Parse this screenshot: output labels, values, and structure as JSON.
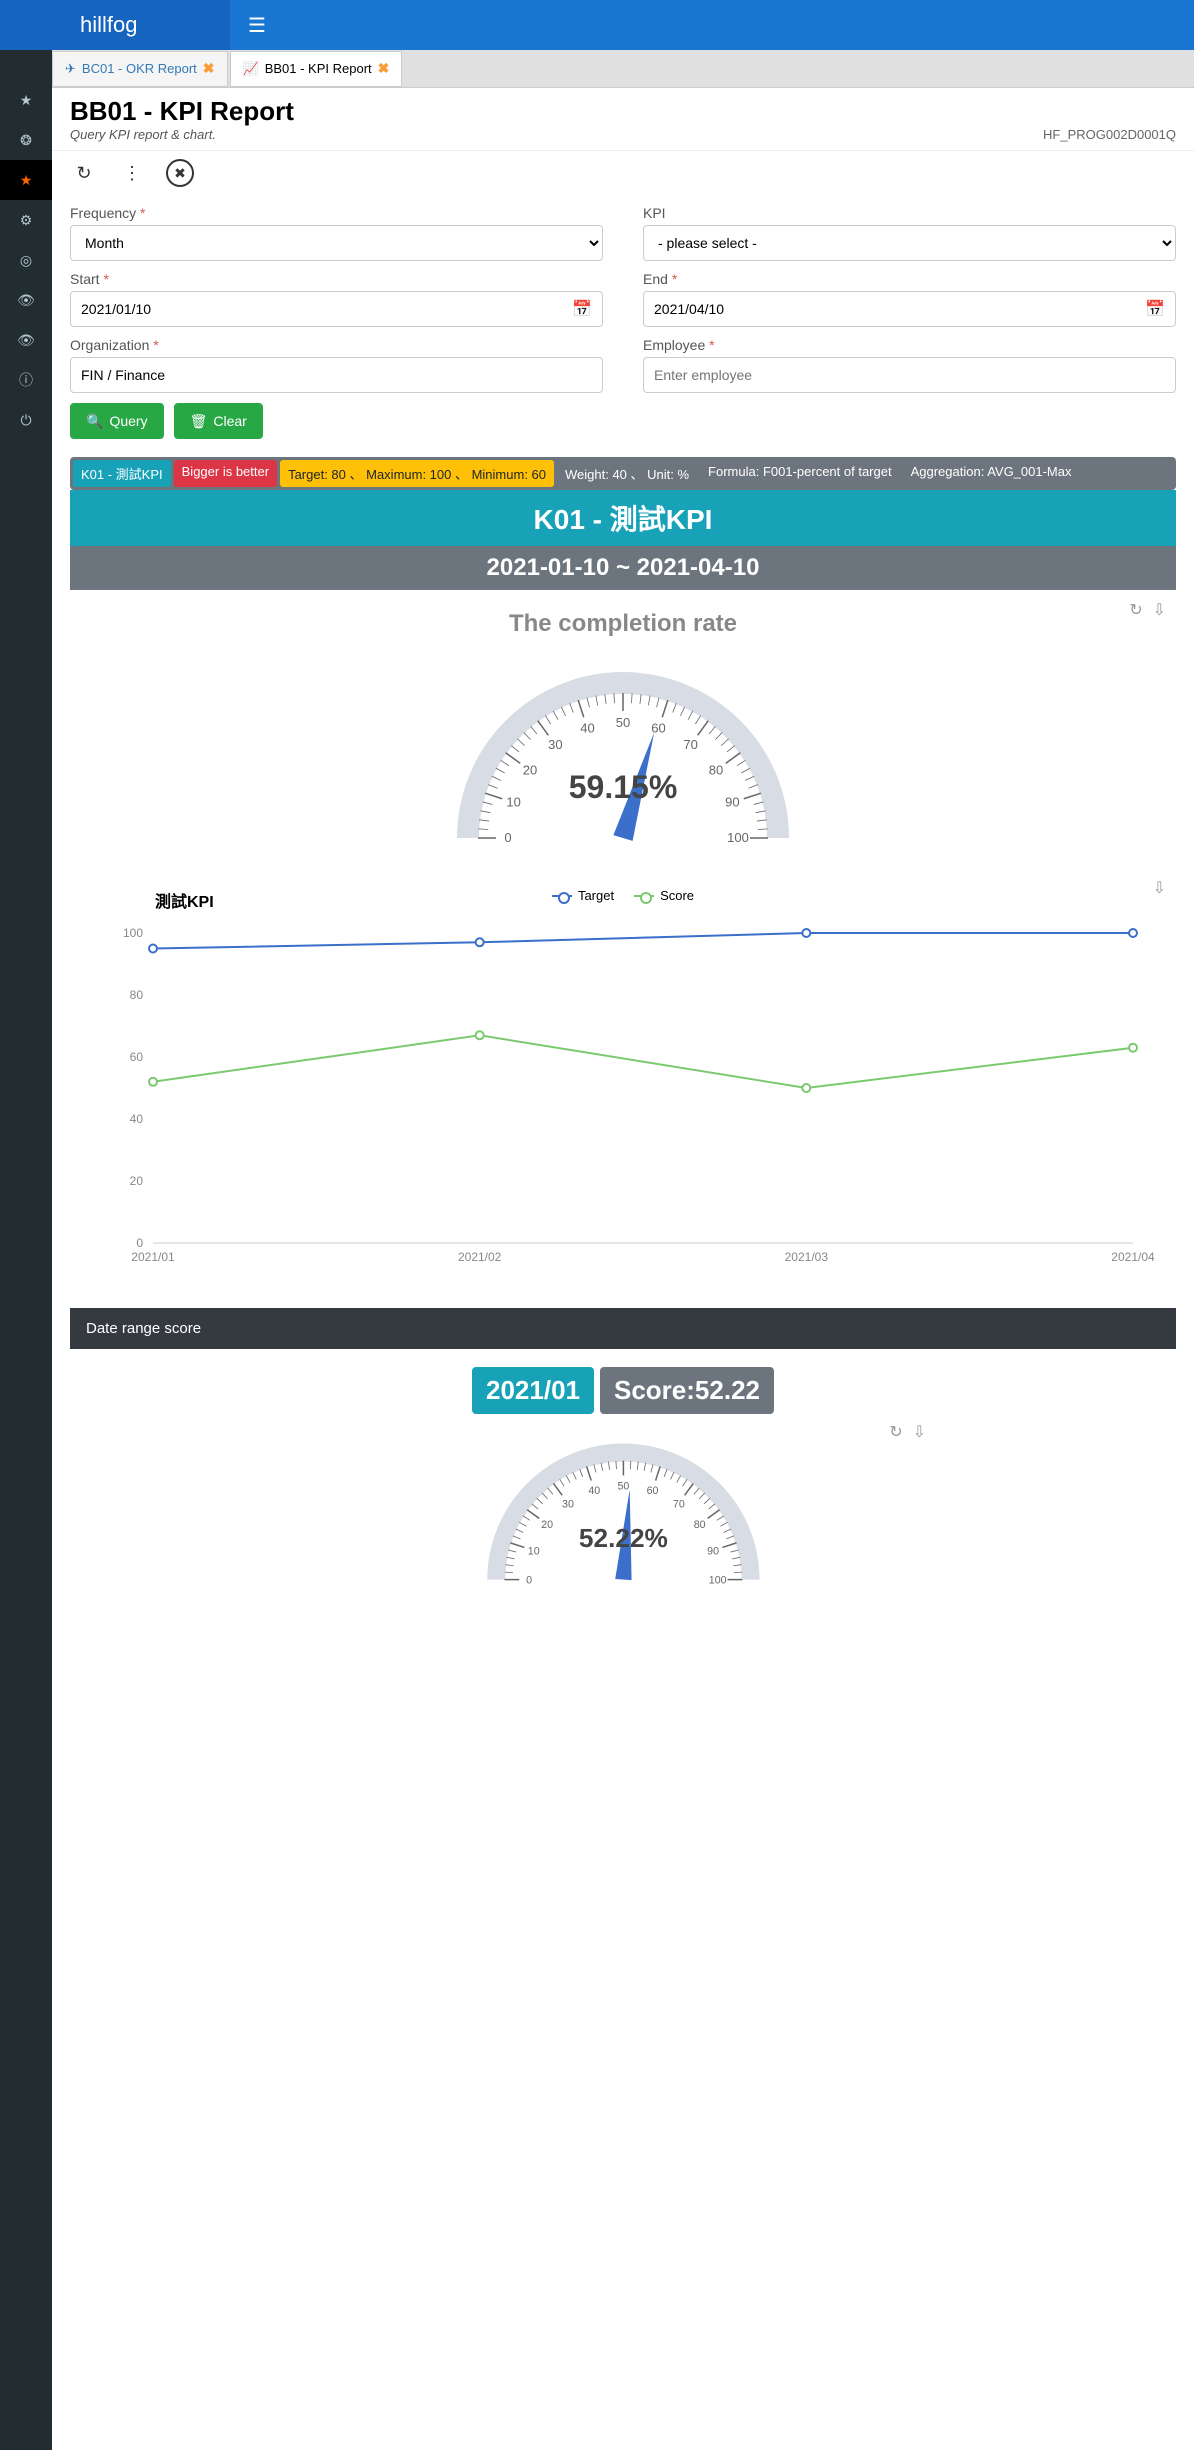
{
  "header": {
    "brand": "hillfog"
  },
  "tabs": [
    {
      "label": "BC01 - OKR Report",
      "active": false
    },
    {
      "label": "BB01 - KPI Report",
      "active": true
    }
  ],
  "page": {
    "title": "BB01 - KPI Report",
    "subtitle": "Query KPI report & chart.",
    "code": "HF_PROG002D0001Q"
  },
  "form": {
    "frequency": {
      "label": "Frequency",
      "value": "Month"
    },
    "kpi": {
      "label": "KPI",
      "value": "- please select -"
    },
    "start": {
      "label": "Start",
      "value": "2021/01/10"
    },
    "end": {
      "label": "End",
      "value": "2021/04/10"
    },
    "organization": {
      "label": "Organization",
      "value": "FIN / Finance"
    },
    "employee": {
      "label": "Employee",
      "placeholder": "Enter employee"
    },
    "query_label": "Query",
    "clear_label": "Clear"
  },
  "kpi_info": {
    "id": "K01 - 測試KPI",
    "comparison": "Bigger is better",
    "targets": "Target: 80 、 Maximum: 100 、 Minimum: 60",
    "weight": "Weight: 40 、 Unit: %",
    "formula": "Formula: F001-percent of target",
    "aggregation": "Aggregation: AVG_001-Max"
  },
  "kpi_title": "K01 - 測試KPI",
  "date_range": "2021-01-10 ~ 2021-04-10",
  "gauge1": {
    "title": "The completion rate",
    "value": "59.15%",
    "numeric": 59.15
  },
  "line_chart": {
    "title": "測試KPI",
    "legend": {
      "target": "Target",
      "score": "Score"
    }
  },
  "section_bar": "Date range score",
  "score_row": {
    "date": "2021/01",
    "score": "Score:52.22"
  },
  "gauge2": {
    "value": "52.22%",
    "numeric": 52.22
  },
  "chart_data": [
    {
      "type": "gauge",
      "title": "The completion rate",
      "value": 59.15,
      "unit": "%",
      "min": 0,
      "max": 100,
      "ticks": [
        0,
        10,
        20,
        30,
        40,
        50,
        60,
        70,
        80,
        90,
        100
      ]
    },
    {
      "type": "line",
      "title": "測試KPI",
      "categories": [
        "2021/01",
        "2021/02",
        "2021/03",
        "2021/04"
      ],
      "series": [
        {
          "name": "Target",
          "values": [
            95,
            97,
            100,
            100
          ]
        },
        {
          "name": "Score",
          "values": [
            52,
            67,
            50,
            63
          ]
        }
      ],
      "ylim": [
        0,
        100
      ],
      "yticks": [
        0,
        20,
        40,
        60,
        80,
        100
      ]
    },
    {
      "type": "gauge",
      "title": "Date range score 2021/01",
      "value": 52.22,
      "unit": "%",
      "min": 0,
      "max": 100,
      "ticks": [
        0,
        10,
        20,
        30,
        40,
        50,
        60,
        70,
        80,
        90,
        100
      ]
    }
  ]
}
